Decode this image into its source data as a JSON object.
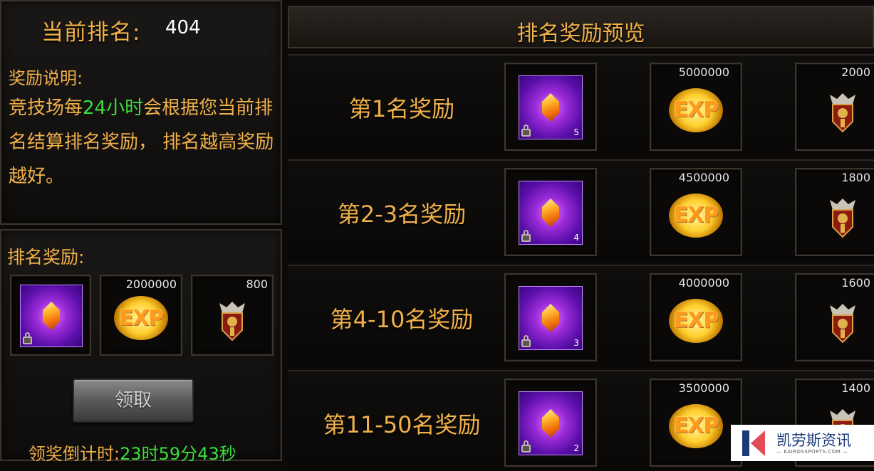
{
  "current_rank": {
    "label": "当前排名:",
    "value": "404"
  },
  "description": {
    "title": "奖励说明:",
    "text_before": "竞技场每",
    "highlight": "24小时",
    "text_after": "会根据您当前排名结算排名奖励， 排名越高奖励越好。"
  },
  "ranking_reward": {
    "title": "排名奖励:",
    "items": [
      {
        "icon": "gem-icon",
        "quantity": "",
        "amount": ""
      },
      {
        "icon": "exp-icon",
        "label": "EXP",
        "amount": "2000000"
      },
      {
        "icon": "medal-icon",
        "amount": "800"
      }
    ],
    "claim_label": "领取",
    "countdown_label": "领奖倒计时:",
    "countdown_value": "23时59分43秒"
  },
  "preview": {
    "title": "排名奖励预览",
    "rows": [
      {
        "label": "第1名奖励",
        "gem_qty": "5",
        "exp": "5000000",
        "medal": "2000"
      },
      {
        "label": "第2-3名奖励",
        "gem_qty": "4",
        "exp": "4500000",
        "medal": "1800"
      },
      {
        "label": "第4-10名奖励",
        "gem_qty": "3",
        "exp": "4000000",
        "medal": "1600"
      },
      {
        "label": "第11-50名奖励",
        "gem_qty": "2",
        "exp": "3500000",
        "medal": "1400"
      }
    ]
  },
  "exp_label": "EXP",
  "watermark": {
    "name": "凯劳斯资讯",
    "sub": "— KAIROSSPORTS.COM —"
  },
  "colors": {
    "accent": "#f0b04a",
    "highlight": "#3bde3b",
    "gem": "#9b2bd9"
  }
}
